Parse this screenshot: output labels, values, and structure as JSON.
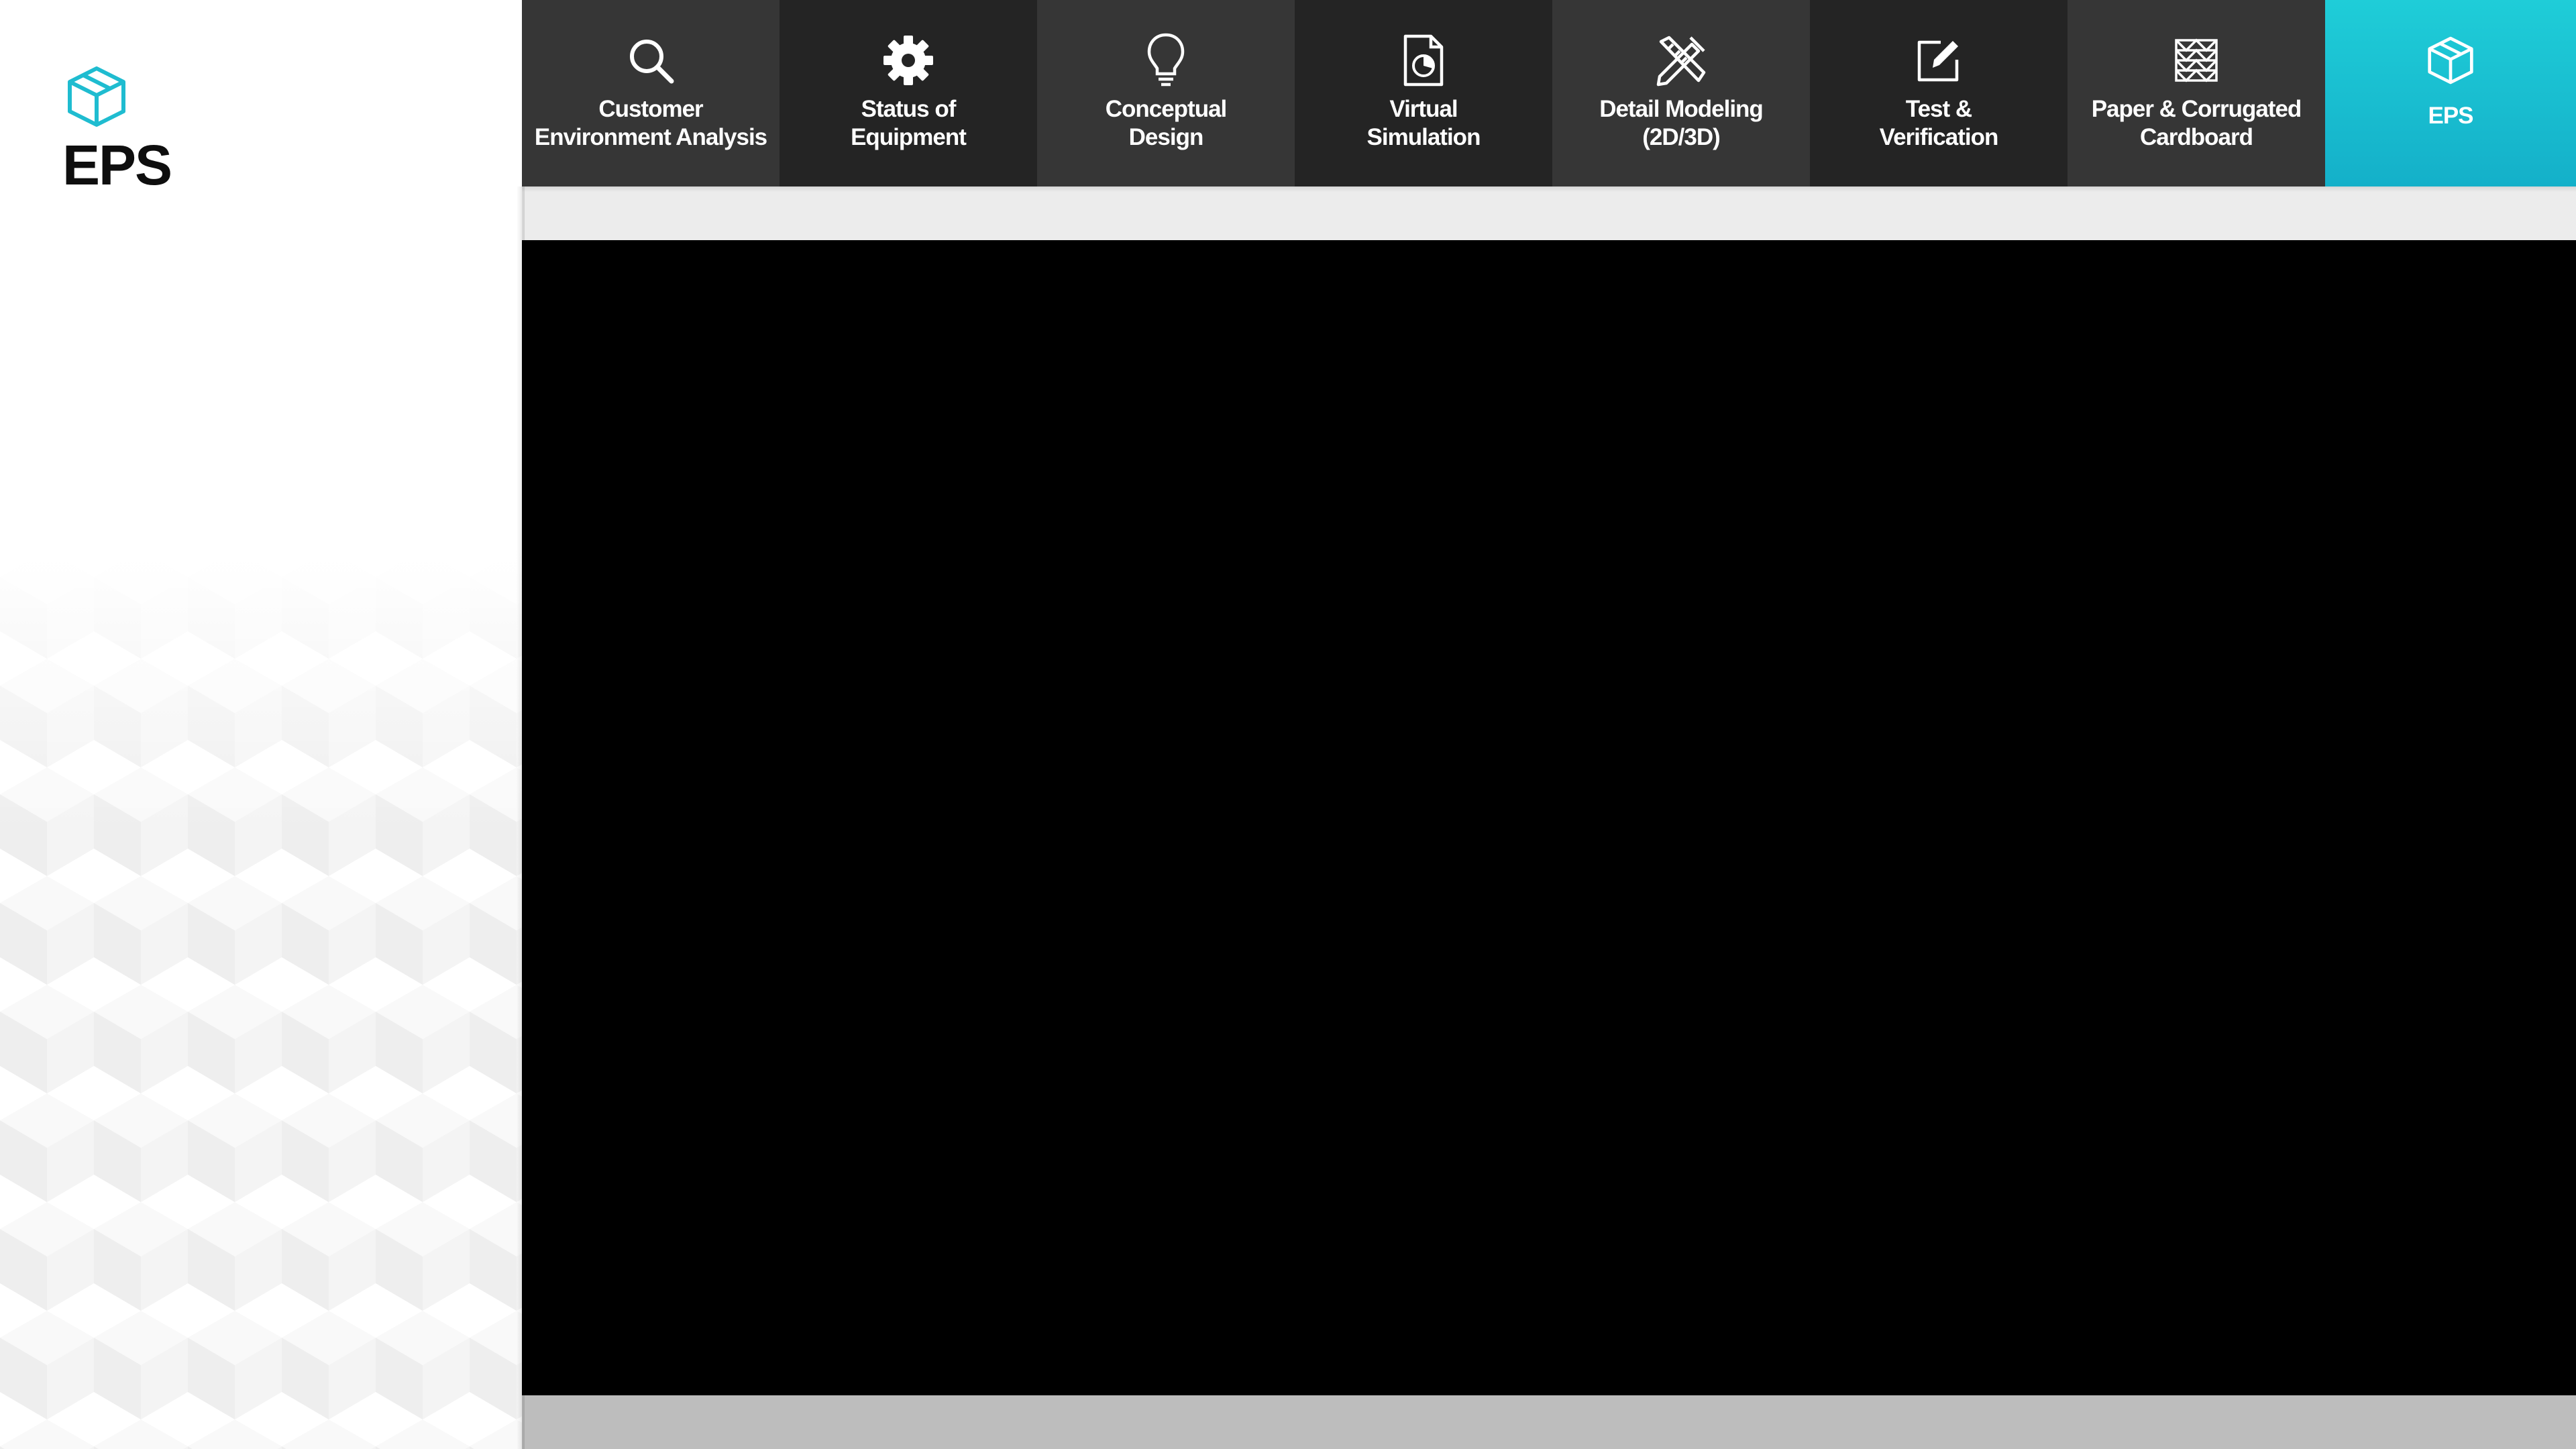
{
  "brand": {
    "title": "EPS",
    "icon": "cube-icon",
    "accent_color": "#1fbcd0"
  },
  "nav": {
    "items": [
      {
        "label": "Customer\nEnvironment Analysis",
        "icon": "search-icon"
      },
      {
        "label": "Status of\nEquipment",
        "icon": "gear-icon"
      },
      {
        "label": "Conceptual\nDesign",
        "icon": "lightbulb-icon"
      },
      {
        "label": "Virtual\nSimulation",
        "icon": "document-chart-icon"
      },
      {
        "label": "Detail Modeling\n(2D/3D)",
        "icon": "pencil-ruler-icon"
      },
      {
        "label": "Test &\nVerification",
        "icon": "edit-icon"
      },
      {
        "label": "Paper & Corrugated\nCardboard",
        "icon": "corrugated-grid-icon"
      },
      {
        "label": "EPS",
        "icon": "cube-icon"
      }
    ],
    "active_index": 7,
    "active_color": "#1fcdd8"
  }
}
